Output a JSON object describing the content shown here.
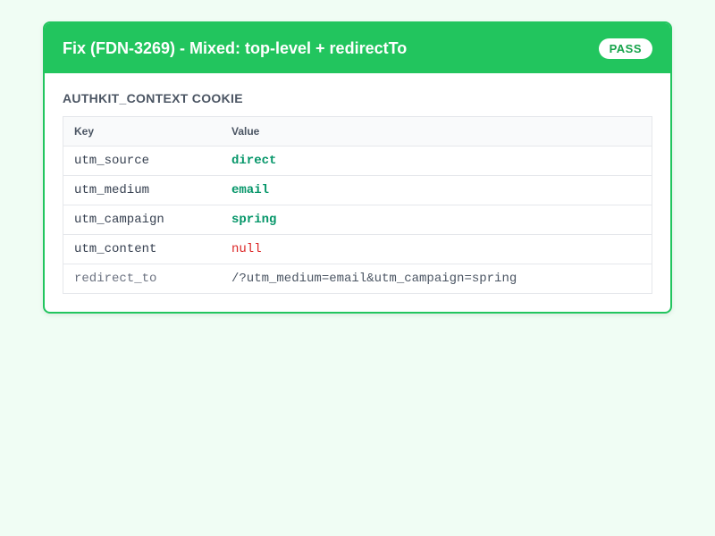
{
  "card": {
    "title": "Fix (FDN-3269) - Mixed: top-level + redirectTo",
    "status": "PASS",
    "section_title": "AUTHKIT_CONTEXT COOKIE",
    "table": {
      "headers": {
        "key": "Key",
        "value": "Value"
      },
      "rows": [
        {
          "key": "utm_source",
          "value": "direct"
        },
        {
          "key": "utm_medium",
          "value": "email"
        },
        {
          "key": "utm_campaign",
          "value": "spring"
        },
        {
          "key": "utm_content",
          "value": "null"
        },
        {
          "key": "redirect_to",
          "value": "/?utm_medium=email&utm_campaign=spring"
        }
      ]
    }
  },
  "colors": {
    "accent": "#22c55e",
    "background": "#f0fdf4",
    "value_ok": "#059669",
    "value_null": "#dc2626"
  }
}
